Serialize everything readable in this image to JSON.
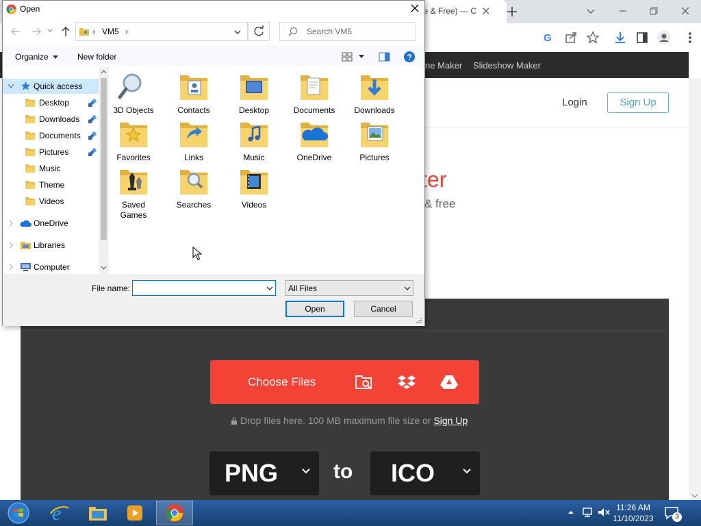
{
  "browser": {
    "tab_title": "e & Free) — C",
    "nav_links": [
      "ne Maker",
      "Slideshow Maker"
    ],
    "login": "Login",
    "signup": "Sign Up",
    "hero_title": "ter",
    "hero_subtitle": "& free",
    "choose_files": "Choose Files",
    "drop_text": "Drop files here. 100 MB maximum file size or ",
    "drop_link": "Sign Up",
    "from_format": "PNG",
    "to_word": "to",
    "to_format": "ICO"
  },
  "dialog": {
    "title": "Open",
    "address": [
      "VM5"
    ],
    "search_placeholder": "Search VM5",
    "organize": "Organize",
    "new_folder": "New folder",
    "nav": {
      "quick_access": "Quick access",
      "quick_items": [
        "Desktop",
        "Downloads",
        "Documents",
        "Pictures",
        "Music",
        "Theme",
        "Videos"
      ],
      "pinned": [
        true,
        true,
        true,
        true,
        false,
        false,
        false
      ],
      "onedrive": "OneDrive",
      "libraries": "Libraries",
      "computer": "Computer"
    },
    "items": [
      {
        "label": "3D Objects",
        "icon": "search-folder-icon"
      },
      {
        "label": "Contacts",
        "icon": "contacts-folder-icon"
      },
      {
        "label": "Desktop",
        "icon": "desktop-folder-icon"
      },
      {
        "label": "Documents",
        "icon": "documents-folder-icon"
      },
      {
        "label": "Downloads",
        "icon": "downloads-folder-icon"
      },
      {
        "label": "Favorites",
        "icon": "favorites-folder-icon"
      },
      {
        "label": "Links",
        "icon": "links-folder-icon"
      },
      {
        "label": "Music",
        "icon": "music-folder-icon"
      },
      {
        "label": "OneDrive",
        "icon": "onedrive-folder-icon"
      },
      {
        "label": "Pictures",
        "icon": "pictures-folder-icon"
      },
      {
        "label": "Saved Games",
        "icon": "saved-games-folder-icon"
      },
      {
        "label": "Searches",
        "icon": "searches-folder-icon"
      },
      {
        "label": "Videos",
        "icon": "videos-folder-icon"
      }
    ],
    "file_name_label": "File name:",
    "file_name_value": "",
    "filter": "All Files",
    "open_button": "Open",
    "cancel_button": "Cancel"
  },
  "taskbar": {
    "time": "11:26 AM",
    "date": "11/10/2023",
    "notification_count": "3"
  },
  "colors": {
    "accent": "#0078d7",
    "brand_red": "#f44336",
    "taskbar": "#1d4f8f"
  }
}
